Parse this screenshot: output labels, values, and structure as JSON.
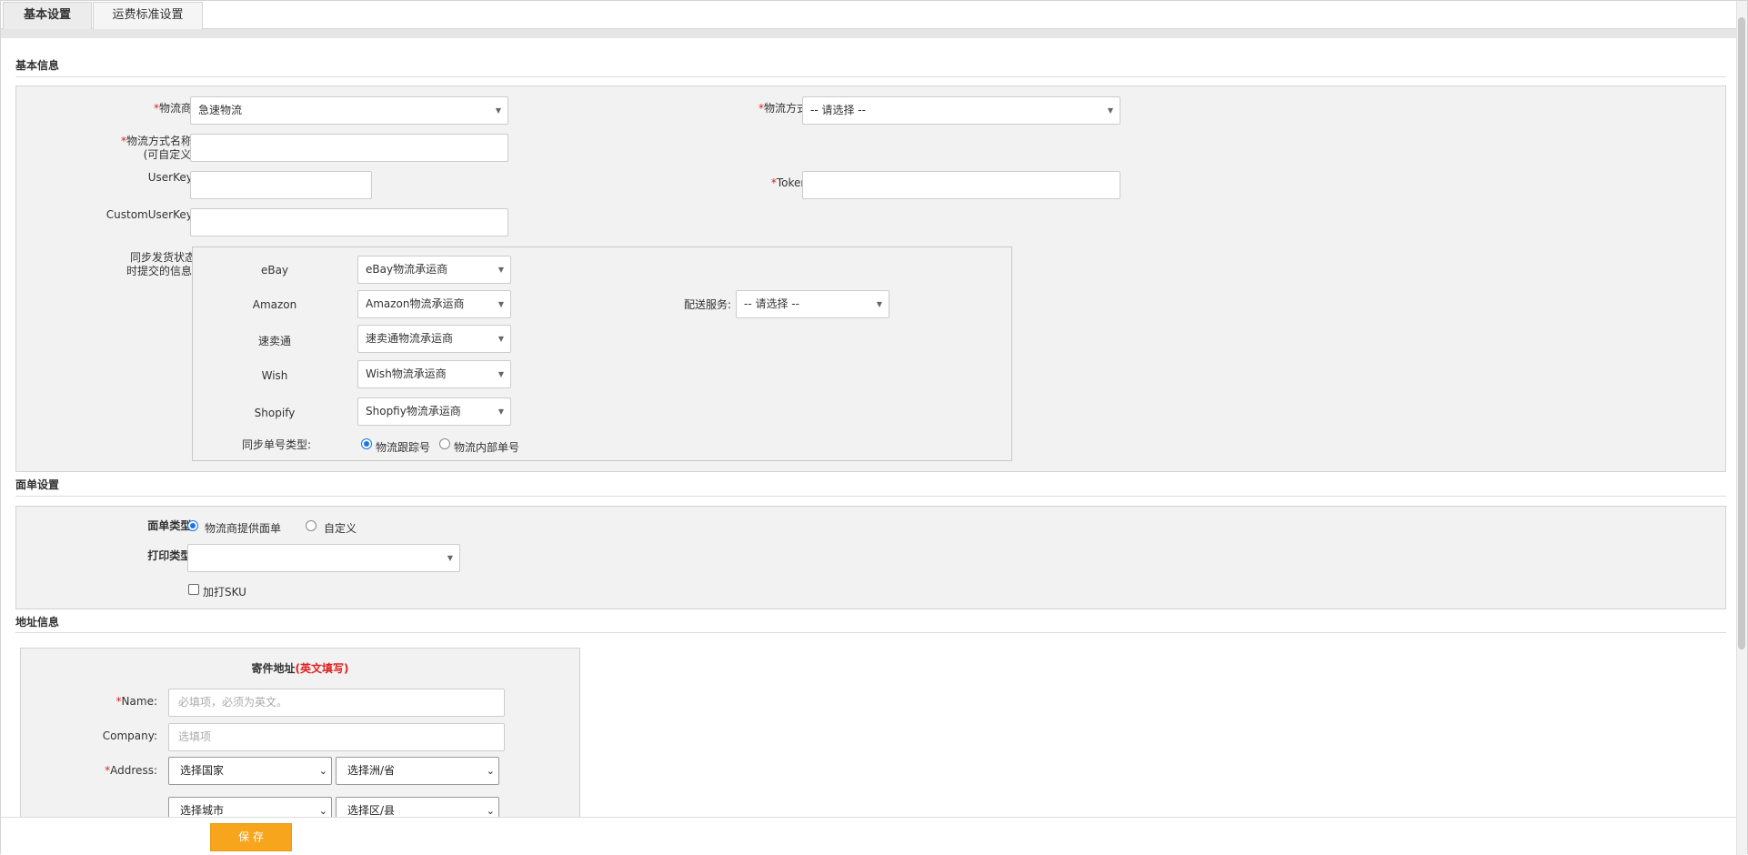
{
  "tabs": [
    {
      "label": "基本设置"
    },
    {
      "label": "运费标准设置"
    }
  ],
  "sections": {
    "basic": "基本信息",
    "label_settings": "面单设置",
    "address": "地址信息"
  },
  "basic": {
    "carrier": {
      "required": "*",
      "label": "物流商:",
      "value": "急速物流"
    },
    "method": {
      "required": "*",
      "label": "物流方式:",
      "value": "-- 请选择 --"
    },
    "method_name": {
      "required": "*",
      "label": "物流方式名称:",
      "sub": "(可自定义)",
      "value": ""
    },
    "userkey": {
      "label": "UserKey:",
      "value": ""
    },
    "token": {
      "required": "*",
      "label": "Token:",
      "value": ""
    },
    "customuserkey": {
      "label": "CustomUserKey:",
      "value": ""
    },
    "sync": {
      "label_line1": "同步发货状态",
      "label_line2": "时提交的信息:",
      "platforms": [
        {
          "name": "eBay",
          "value": "eBay物流承运商"
        },
        {
          "name": "Amazon",
          "value": "Amazon物流承运商"
        },
        {
          "name": "速卖通",
          "value": "速卖通物流承运商"
        },
        {
          "name": "Wish",
          "value": "Wish物流承运商"
        },
        {
          "name": "Shopify",
          "value": "Shopfiy物流承运商"
        }
      ],
      "delivery_service": {
        "label": "配送服务:",
        "value": "-- 请选择 --"
      },
      "number_type": {
        "label": "同步单号类型:",
        "options": [
          "物流跟踪号",
          "物流内部单号"
        ],
        "selected": "物流跟踪号"
      }
    }
  },
  "label_settings": {
    "type": {
      "label": "面单类型:",
      "options": [
        "物流商提供面单",
        "自定义"
      ],
      "selected": "物流商提供面单"
    },
    "print_type": {
      "label": "打印类型:",
      "value": ""
    },
    "print_sku": {
      "label": "加打SKU",
      "checked": false
    }
  },
  "address": {
    "title": "寄件地址",
    "title_note": "(英文填写)",
    "name": {
      "required": "*",
      "label": "Name:",
      "placeholder": "必填项，必须为英文。"
    },
    "company": {
      "label": "Company:",
      "placeholder": "选填项"
    },
    "address": {
      "required": "*",
      "label": "Address:",
      "country": "选择国家",
      "state": "选择洲/省",
      "city": "选择城市",
      "district": "选择区/县"
    }
  },
  "footer": {
    "save_label": "保 存"
  },
  "colors": {
    "accent": "#f7a51d",
    "required": "#e02020",
    "radio": "#1a73e8"
  }
}
